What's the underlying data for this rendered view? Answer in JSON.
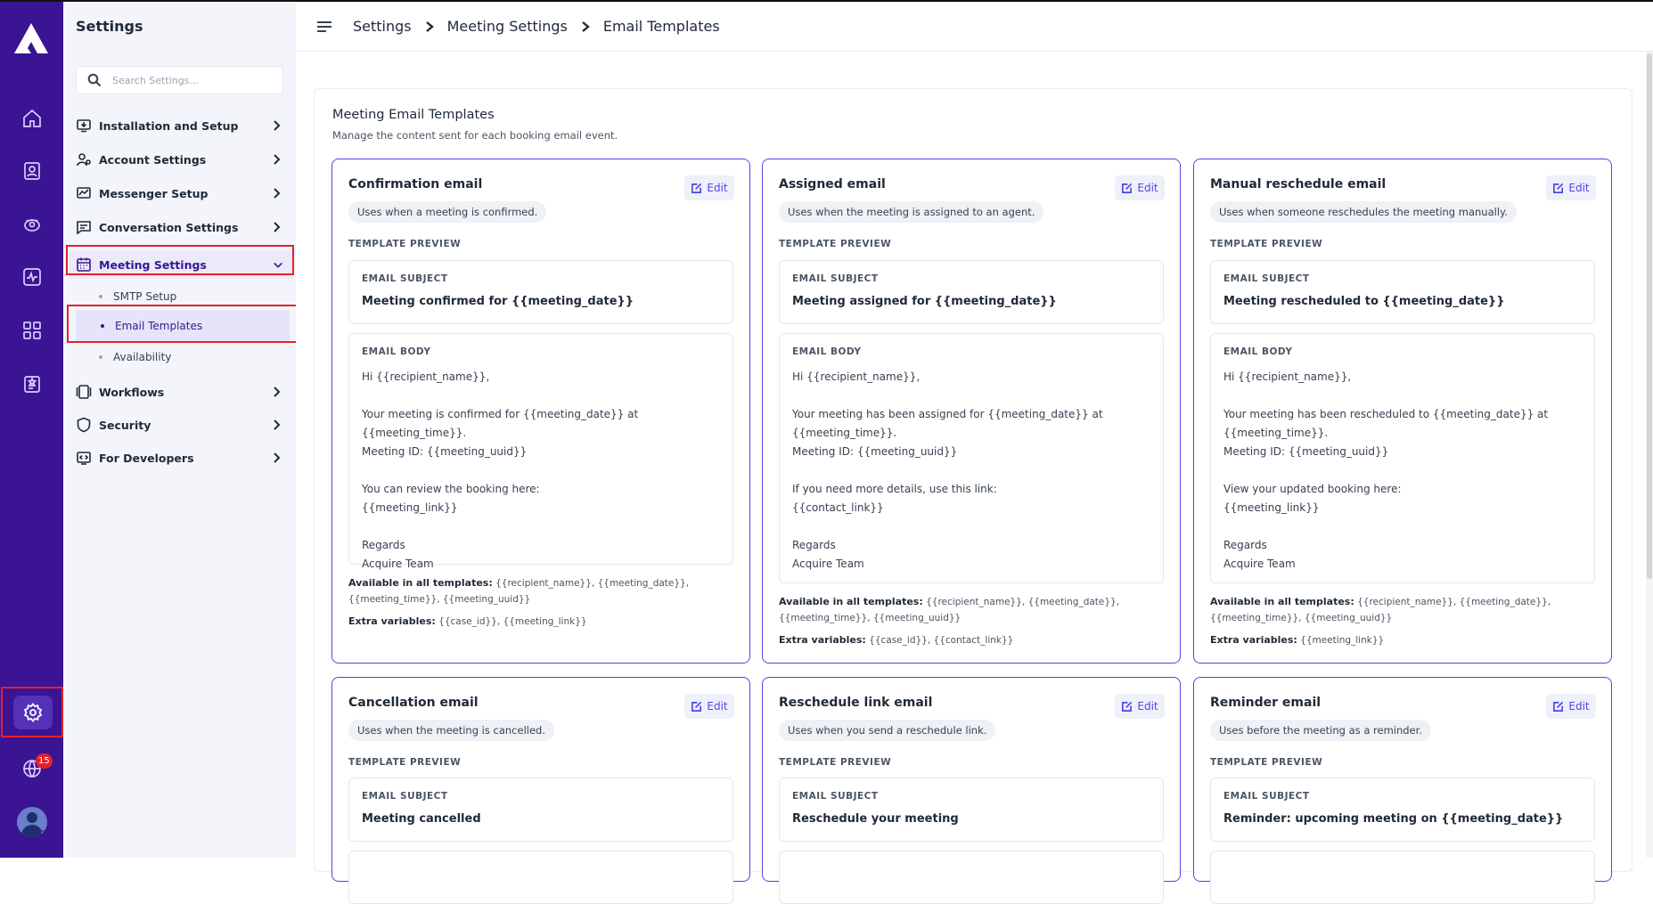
{
  "sidebar": {
    "title": "Settings",
    "search_placeholder": "Search Settings...",
    "items": [
      {
        "label": "Installation and Setup"
      },
      {
        "label": "Account Settings"
      },
      {
        "label": "Messenger Setup"
      },
      {
        "label": "Conversation Settings"
      },
      {
        "label": "Meeting Settings"
      },
      {
        "label": "Workflows"
      },
      {
        "label": "Security"
      },
      {
        "label": "For Developers"
      }
    ],
    "sub_items": [
      {
        "label": "SMTP Setup"
      },
      {
        "label": "Email Templates"
      },
      {
        "label": "Availability"
      }
    ]
  },
  "rail": {
    "notification_count": "15",
    "icons": [
      "home-icon",
      "contacts-icon",
      "bot-icon",
      "activity-icon",
      "apps-icon",
      "report-icon",
      "settings-icon",
      "help-globe-icon",
      "avatar"
    ]
  },
  "breadcrumb": [
    "Settings",
    "Meeting Settings",
    "Email Templates"
  ],
  "page": {
    "title": "Meeting Email Templates",
    "subtitle": "Manage the content sent for each booking email event.",
    "template_preview_label": "TEMPLATE PREVIEW",
    "email_subject_label": "EMAIL SUBJECT",
    "email_body_label": "EMAIL BODY",
    "available_label": "Available in all templates:",
    "extra_label": "Extra variables:",
    "edit_label": "Edit"
  },
  "cards": [
    {
      "title": "Confirmation email",
      "description": "Uses when a meeting is confirmed.",
      "subject": "Meeting confirmed for {{meeting_date}}",
      "body": "Hi {{recipient_name}},\n\nYour meeting is confirmed for {{meeting_date}} at {{meeting_time}}.\nMeeting ID: {{meeting_uuid}}\n\nYou can review the booking here:\n{{meeting_link}}\n\nRegards\nAcquire Team",
      "available": "{{recipient_name}}, {{meeting_date}}, {{meeting_time}}, {{meeting_uuid}}",
      "extra": "{{case_id}}, {{meeting_link}}"
    },
    {
      "title": "Assigned email",
      "description": "Uses when the meeting is assigned to an agent.",
      "subject": "Meeting assigned for {{meeting_date}}",
      "body": "Hi {{recipient_name}},\n\nYour meeting has been assigned for {{meeting_date}} at\n{{meeting_time}}.\nMeeting ID: {{meeting_uuid}}\n\nIf you need more details, use this link:\n{{contact_link}}\n\nRegards\nAcquire Team",
      "available": "{{recipient_name}}, {{meeting_date}}, {{meeting_time}}, {{meeting_uuid}}",
      "extra": "{{case_id}}, {{contact_link}}"
    },
    {
      "title": "Manual reschedule email",
      "description": "Uses when someone reschedules the meeting manually.",
      "subject": "Meeting rescheduled to {{meeting_date}}",
      "body": "Hi {{recipient_name}},\n\nYour meeting has been rescheduled to {{meeting_date}} at\n{{meeting_time}}.\nMeeting ID: {{meeting_uuid}}\n\nView your updated booking here:\n{{meeting_link}}\n\nRegards\nAcquire Team",
      "available": "{{recipient_name}}, {{meeting_date}}, {{meeting_time}}, {{meeting_uuid}}",
      "extra": "{{meeting_link}}"
    },
    {
      "title": "Cancellation email",
      "description": "Uses when the meeting is cancelled.",
      "subject": "Meeting cancelled"
    },
    {
      "title": "Reschedule link email",
      "description": "Uses when you send a reschedule link.",
      "subject": "Reschedule your meeting"
    },
    {
      "title": "Reminder email",
      "description": "Uses before the meeting as a reminder.",
      "subject": "Reminder: upcoming meeting on {{meeting_date}}"
    }
  ],
  "colors": {
    "rail_bg": "#3a1493",
    "accent": "#4f46e5",
    "highlight_box": "#e5202a",
    "badge": "#e5202a"
  }
}
